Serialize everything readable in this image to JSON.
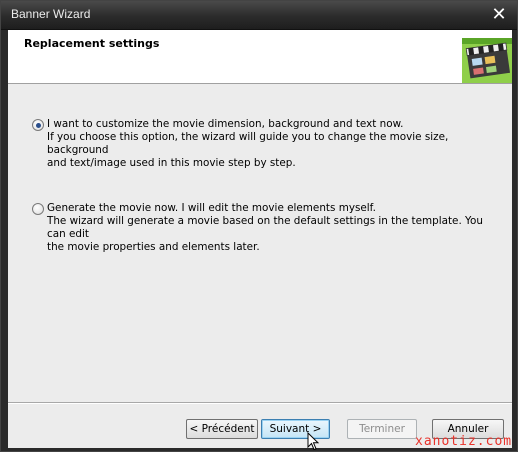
{
  "window": {
    "title": "Banner Wizard",
    "close_glyph": "✕"
  },
  "header": {
    "title": "Replacement settings",
    "graphic_icon": "clapperboard-film-icon"
  },
  "options": [
    {
      "selected": true,
      "line1": "I want to customize the movie dimension, background and text now.",
      "line2": "If you choose this option, the wizard will guide you to change the movie size, background",
      "line3": "and text/image used in this movie step by step."
    },
    {
      "selected": false,
      "line1": "Generate the movie now. I will edit the movie elements myself.",
      "line2": "The wizard will generate a movie based on the default settings in the template. You can edit",
      "line3": "the movie properties and elements later."
    }
  ],
  "buttons": {
    "previous": "< Précédent",
    "next": "Suivant >",
    "finish": "Terminer",
    "cancel": "Annuler"
  },
  "watermark": "xanotiz.com",
  "colors": {
    "accent": "#3c7fb1",
    "watermark": "#e8322a",
    "titlebar": "#2b2b2b"
  }
}
